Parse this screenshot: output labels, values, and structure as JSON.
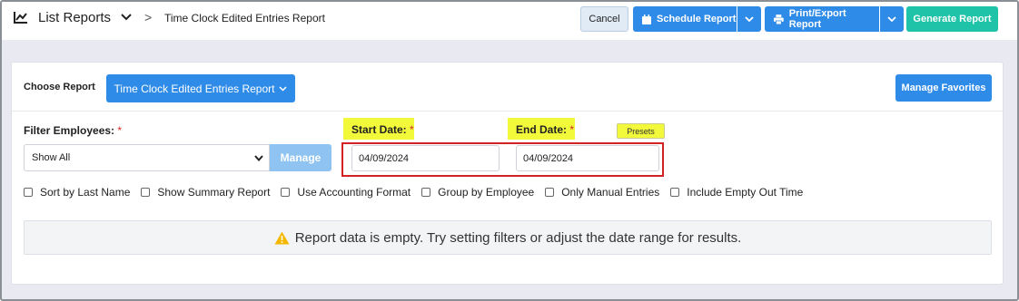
{
  "nav": {
    "title": "List Reports",
    "breadcrumb_sep": ">",
    "breadcrumb": "Time Clock Edited Entries Report"
  },
  "toolbar": {
    "cancel_label": "Cancel",
    "schedule_label": "Schedule Report",
    "print_label": "Print/Export Report",
    "generate_label": "Generate Report"
  },
  "report": {
    "choose_label": "Choose Report",
    "selected_report": "Time Clock Edited Entries Report",
    "manage_favorites_label": "Manage Favorites"
  },
  "filters": {
    "employees_label": "Filter Employees:",
    "required_mark": "*",
    "employees_value": "Show All",
    "manage_label": "Manage",
    "start_date_label": "Start Date:",
    "start_date_value": "04/09/2024",
    "end_date_label": "End Date:",
    "end_date_value": "04/09/2024",
    "presets_label": "Presets"
  },
  "options": [
    {
      "label": "Sort by Last Name",
      "checked": false
    },
    {
      "label": "Show Summary Report",
      "checked": false
    },
    {
      "label": "Use Accounting Format",
      "checked": false
    },
    {
      "label": "Group by Employee",
      "checked": false
    },
    {
      "label": "Only Manual Entries",
      "checked": false
    },
    {
      "label": "Include Empty Out Time",
      "checked": false
    }
  ],
  "empty_message": "Report data is empty. Try setting filters or adjust the date range for results.",
  "colors": {
    "primary": "#2f8be8",
    "generate": "#1ec3a8",
    "highlight": "#f2f83a",
    "required": "#d42a2a",
    "warning": "#f5b800"
  },
  "icons": {
    "nav": "chart-line-icon",
    "schedule": "calendar-icon",
    "print": "printer-icon",
    "empty": "warning-triangle-icon"
  }
}
